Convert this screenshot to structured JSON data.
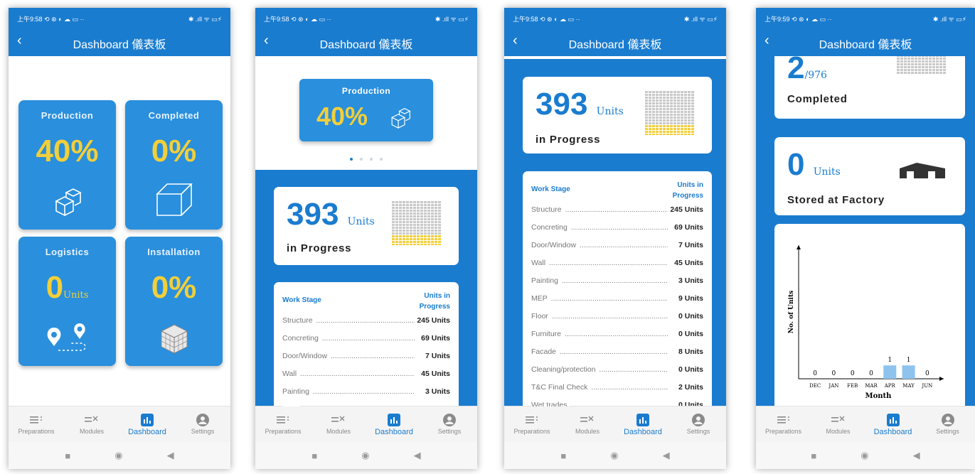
{
  "status": {
    "time": "上午9:58 ⟲ ⊛ ◐ ☁ ▭ ··",
    "time4": "上午9:59 ⟲ ⊛ ◐ ☁ ▭ ··",
    "right": "✱ .ıll ᯤ ▭⚡"
  },
  "appbar": {
    "title": "Dashboard 儀表板",
    "back_icon": "chevron-left-icon"
  },
  "nav": {
    "items": [
      {
        "label": "Preparations",
        "icon": "list-icon"
      },
      {
        "label": "Modules",
        "icon": "checklist-icon"
      },
      {
        "label": "Dashboard",
        "icon": "bar-chart-icon",
        "active": true
      },
      {
        "label": "Settings",
        "icon": "user-circle-icon"
      }
    ]
  },
  "tiles": {
    "production": {
      "label": "Production",
      "value": "40%"
    },
    "completed": {
      "label": "Completed",
      "value": "0%"
    },
    "logistics": {
      "label": "Logistics",
      "value": "0",
      "unit": "Units"
    },
    "installation": {
      "label": "Installation",
      "value": "0%"
    }
  },
  "carousel": {
    "label": "Production",
    "value": "40%",
    "page": 1,
    "pages": 4
  },
  "in_progress": {
    "value": "393",
    "unit": "Units",
    "caption": "in Progress"
  },
  "work_table": {
    "header_stage": "Work Stage",
    "header_units_line1": "Units in",
    "header_units_line2": "Progress",
    "rows": [
      {
        "stage": "Structure",
        "units": "245 Units"
      },
      {
        "stage": "Concreting",
        "units": "69 Units"
      },
      {
        "stage": "Door/Window",
        "units": "7 Units"
      },
      {
        "stage": "Wall",
        "units": "45 Units"
      },
      {
        "stage": "Painting",
        "units": "3 Units"
      },
      {
        "stage": "MEP",
        "units": "9 Units"
      },
      {
        "stage": "Floor",
        "units": "0 Units"
      },
      {
        "stage": "Furniture",
        "units": "0 Units"
      },
      {
        "stage": "Facade",
        "units": "8 Units"
      },
      {
        "stage": "Cleaning/protection",
        "units": "0 Units"
      },
      {
        "stage": "T&C Final Check",
        "units": "2 Units"
      },
      {
        "stage": "Wet trades",
        "units": "0 Units"
      }
    ]
  },
  "completed_card": {
    "value": "2",
    "total": "/976",
    "caption": "Completed"
  },
  "stored_card": {
    "value": "0",
    "unit": "Units",
    "caption": "Stored at Factory"
  },
  "chart_data": {
    "type": "bar",
    "categories": [
      "DEC",
      "JAN",
      "FEB",
      "MAR",
      "APR",
      "MAY",
      "JUN"
    ],
    "values": [
      0,
      0,
      0,
      0,
      1,
      1,
      0
    ],
    "xlabel": "Month",
    "ylabel": "No. of Units",
    "ylim": [
      0,
      10
    ],
    "bar_color": "#8ec3ee"
  },
  "colors": {
    "primary": "#1a7ccf",
    "tile": "#2a8fdc",
    "accent": "#f2cf3a"
  }
}
